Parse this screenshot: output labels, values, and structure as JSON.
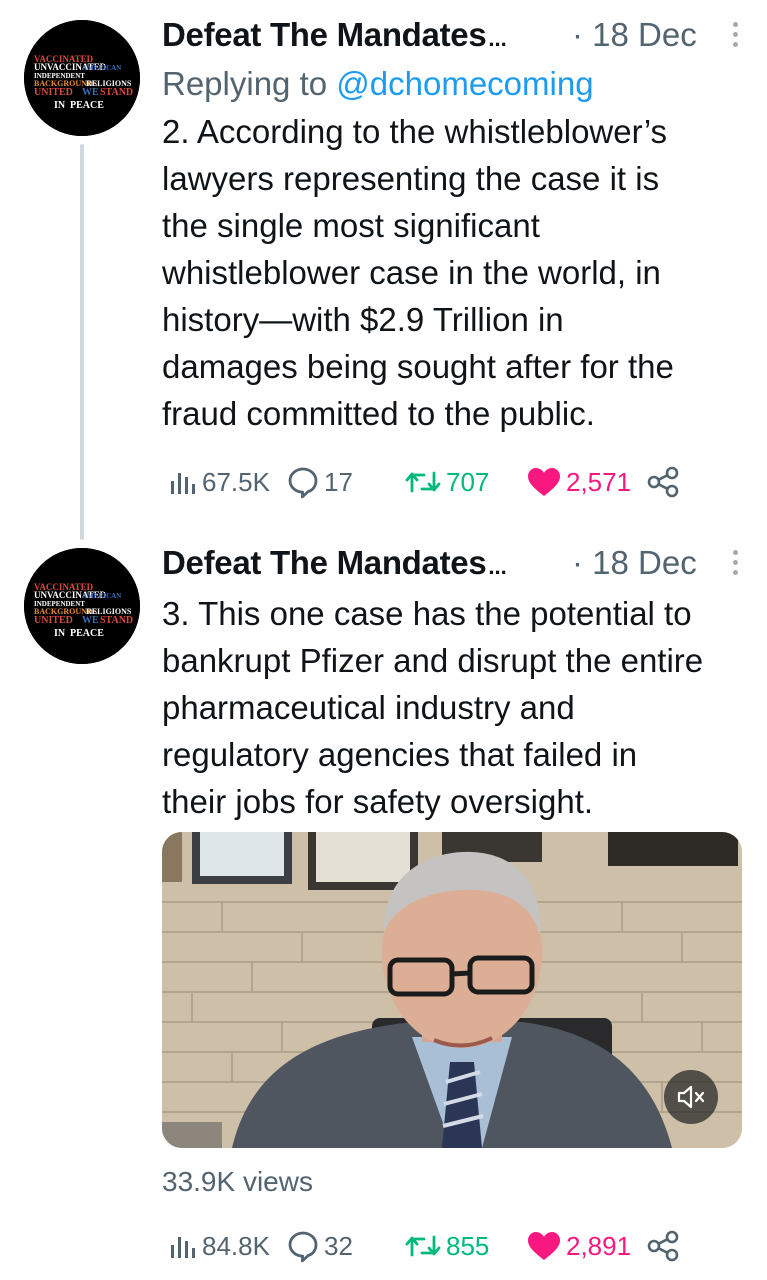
{
  "tweets": [
    {
      "author": "Defeat The Mandates",
      "ellipsis": "...",
      "date": "· 18 Dec",
      "replying_prefix": "Replying to ",
      "replying_handle": "@dchomecoming",
      "text": "2. According to the whistleblower’s\nlawyers representing the case it is\nthe single most significant\nwhistleblower case in the world, in\nhistory—with $2.9 Trillion in\ndamages being sought after for the\nfraud committed to the public.",
      "stats": {
        "views": "67.5K",
        "replies": "17",
        "retweets": "707",
        "likes": "2,571"
      }
    },
    {
      "author": "Defeat The Mandates",
      "ellipsis": "...",
      "date": "· 18 Dec",
      "text": "3. This one case has the potential to\nbankrupt Pfizer and disrupt the entire\npharmaceutical industry and\nregulatory agencies that failed in\ntheir jobs for safety oversight.",
      "video_views": "33.9K views",
      "stats": {
        "views": "84.8K",
        "replies": "32",
        "retweets": "855",
        "likes": "2,891"
      }
    }
  ],
  "avatar_words": [
    "VACCINATED",
    "UNVACCINATED",
    "INDEPENDENT",
    "AMERICAN",
    "BACKGROUNDS",
    "RELIGIONS",
    "UNITED",
    "WE",
    "STAND",
    "IN",
    "PEACE"
  ],
  "icons": {
    "views": "bar-chart-icon",
    "reply": "speech-bubble-icon",
    "retweet": "retweet-icon",
    "like": "heart-icon",
    "share": "share-icon",
    "more": "more-vertical-icon",
    "mute": "speaker-muted-icon"
  },
  "colors": {
    "text": "#0f1419",
    "secondary": "#536471",
    "link": "#1d9bf0",
    "retweet": "#00ba7c",
    "like": "#f91880"
  }
}
